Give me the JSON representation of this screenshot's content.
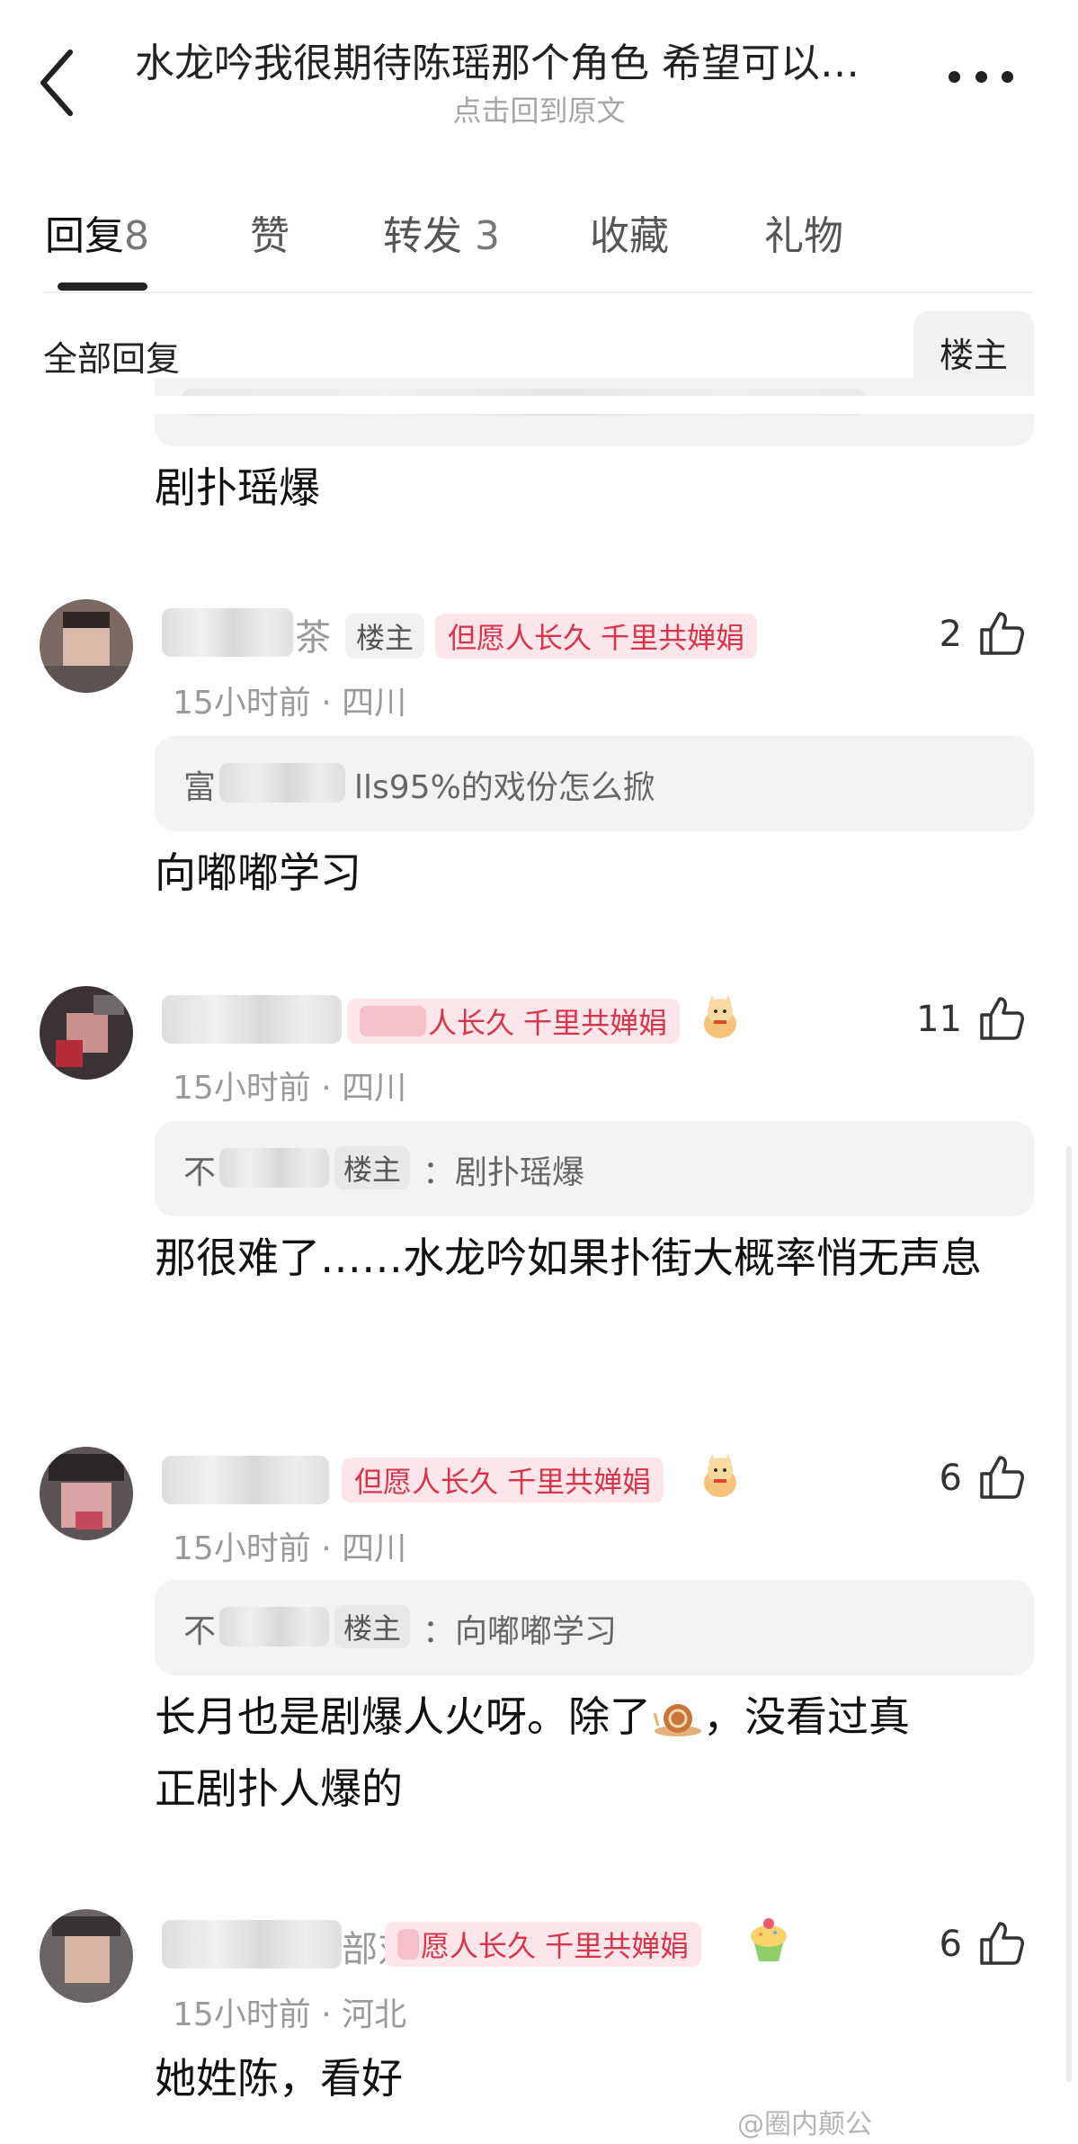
{
  "header": {
    "title": "水龙吟我很期待陈瑶那个角色 希望可以…",
    "subtitle": "点击回到原文"
  },
  "tabs": [
    {
      "label": "回复",
      "count": "8"
    },
    {
      "label": "赞",
      "count": ""
    },
    {
      "label": "转发",
      "count": "3"
    },
    {
      "label": "收藏",
      "count": ""
    },
    {
      "label": "礼物",
      "count": ""
    }
  ],
  "filter": {
    "all_label": "全部回复",
    "owner_label": "楼主"
  },
  "comments": [
    {
      "body": "剧扑瑶爆"
    },
    {
      "nick_tail": "茶",
      "owner_tag": "楼主",
      "fan_tag": "但愿人长久 千里共婵娟",
      "likes": "2",
      "time_location": "15小时前 · 四川",
      "quote_prefix": "富",
      "quote_text": "lls95%的戏份怎么掀",
      "body": "向嘟嘟学习"
    },
    {
      "fan_tag_visible": "人长久 千里共婵娟",
      "badge": "cat-badge-icon",
      "likes": "11",
      "time_location": "15小时前 · 四川",
      "quote_prefix": "不",
      "quote_owner_tag": "楼主",
      "quote_text": "：剧扑瑶爆",
      "body": "那很难了……水龙吟如果扑街大概率悄无声息"
    },
    {
      "fan_tag": "但愿人长久 千里共婵娟",
      "badge": "cat-badge-icon",
      "likes": "6",
      "time_location": "15小时前 · 四川",
      "quote_prefix": "不",
      "quote_owner_tag": "楼主",
      "quote_text": "：向嘟嘟学习",
      "body_part1": "长月也是剧爆人火呀。除了",
      "body_part2": "，没看过真",
      "body_line2": "正剧扑人爆的",
      "inline_emoji": "snail-emoji-icon"
    },
    {
      "nick_tail": "部对",
      "fan_tag_visible": "愿人长久 千里共婵娟",
      "badge": "cupcake-badge-icon",
      "likes": "6",
      "time_location": "15小时前 · 河北",
      "body": "她姓陈，看好"
    }
  ],
  "watermark": "@圈内颠公",
  "colors": {
    "fan_tag_text": "#d8344c",
    "fan_tag_bg": "#fde6ea",
    "meta": "#9a9a9a"
  }
}
